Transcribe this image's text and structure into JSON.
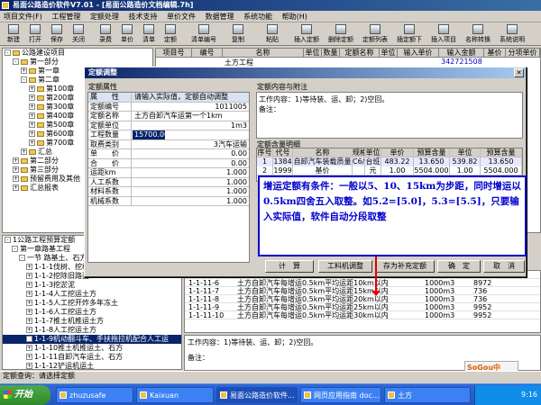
{
  "app": {
    "title": "易面公路造价软件V7.01 - [易面公路造价文档编辑.7h]"
  },
  "menu": [
    "项目文件(F)",
    "工程管理",
    "定额处理",
    "技术支持",
    "单价文件",
    "数据管理",
    "系统功能",
    "帮助(H)"
  ],
  "toolbar": [
    {
      "label": "新建",
      "icon": "new-file-icon"
    },
    {
      "label": "打开",
      "icon": "open-folder-icon"
    },
    {
      "label": "保存",
      "icon": "save-icon"
    },
    {
      "label": "关闭",
      "icon": "close-doc-icon"
    },
    {
      "label": "录费",
      "icon": "fee-icon"
    },
    {
      "label": "单价",
      "icon": "price-icon"
    },
    {
      "label": "清单",
      "icon": "list-icon"
    },
    {
      "label": "定额",
      "icon": "quota-icon"
    },
    {
      "label": "清单编号",
      "icon": "code-icon"
    },
    {
      "label": "复制",
      "icon": "copy-icon"
    },
    {
      "label": "粘贴",
      "icon": "paste-icon"
    },
    {
      "label": "插入定额",
      "icon": "insert-icon"
    },
    {
      "label": "删除定额",
      "icon": "delete-icon"
    },
    {
      "label": "定额列表",
      "icon": "quota-list-icon"
    },
    {
      "label": "插定额下",
      "icon": "insert-below-icon"
    },
    {
      "label": "插入项目",
      "icon": "insert-item-icon"
    },
    {
      "label": "名称转换",
      "icon": "convert-icon"
    },
    {
      "label": "系统说明",
      "icon": "help-doc-icon"
    }
  ],
  "left_tree": [
    {
      "label": "公路建设项目",
      "indent": 0,
      "box": "-"
    },
    {
      "label": "第一部分",
      "indent": 1,
      "box": "-"
    },
    {
      "label": "第一章",
      "indent": 2,
      "box": "+"
    },
    {
      "label": "第二章",
      "indent": 2,
      "box": "-"
    },
    {
      "label": "第100章",
      "indent": 3,
      "box": "+"
    },
    {
      "label": "第200章",
      "indent": 3,
      "box": "+"
    },
    {
      "label": "第300章",
      "indent": 3,
      "box": "+"
    },
    {
      "label": "第400章",
      "indent": 3,
      "box": "+"
    },
    {
      "label": "第500章",
      "indent": 3,
      "box": "+"
    },
    {
      "label": "第600章",
      "indent": 3,
      "box": "+"
    },
    {
      "label": "第700章",
      "indent": 3,
      "box": "+"
    },
    {
      "label": "汇总",
      "indent": 2,
      "box": "+"
    },
    {
      "label": "第二部分",
      "indent": 1,
      "box": "+"
    },
    {
      "label": "第三部分",
      "indent": 1,
      "box": "+"
    },
    {
      "label": "预留费用及其他",
      "indent": 1,
      "box": "+"
    },
    {
      "label": "汇总报表",
      "indent": 1,
      "box": "+"
    }
  ],
  "right_grid": {
    "headers": [
      "项目号",
      "编号",
      "名称",
      "单位",
      "数量",
      "定额名称",
      "单位",
      "输入单价",
      "输入金额",
      "基价",
      "分项单价"
    ],
    "row": {
      "name": "土方工程",
      "amount": "342721508"
    }
  },
  "left_tree2": [
    "1公路工程预算定额",
    "第一章路基工程",
    "一节 路基土、石方工程",
    "1-1-1伐树、挖根、除草",
    "1-1-2挖除旧路面",
    "1-1-3挖淤泥",
    "1-1-4人工挖运土方",
    "1-1-5人工挖开炸多年冻土",
    "1-1-6人工挖运土方",
    "1-1-7推土机推运土方",
    "1-1-8人工挖运土方",
    "1-1-9机动翻斗车、手扶拖拉机配合人工运",
    "1-1-10推土机推运土、石方",
    "1-1-11自卸汽车运土、石方",
    "1-1-12铲运机运土",
    "1-1-13平地机整平"
  ],
  "bottom_grid": [
    {
      "code": "1-1-11-5",
      "name": "土方自卸汽车运第一个1km",
      "unit": "1000m3",
      "price": "8972"
    },
    {
      "code": "1-1-11-6",
      "name": "土方自卸汽车每增运0.5km平均运距10km以内",
      "unit": "1000m3",
      "price": "8972"
    },
    {
      "code": "1-1-11-7",
      "name": "土方自卸汽车每增运0.5km平均运距15km以内",
      "unit": "1000m3",
      "price": "736"
    },
    {
      "code": "1-1-11-8",
      "name": "土方自卸汽车每增运0.5km平均运距20km以内",
      "unit": "1000m3",
      "price": "736"
    },
    {
      "code": "1-1-11-9",
      "name": "土方自卸汽车每增运0.5km平均运距25km以内",
      "unit": "1000m3",
      "price": "9952"
    },
    {
      "code": "1-1-11-10",
      "name": "土方自卸汽车每增运0.5km平均运距30km以内",
      "unit": "1000m3",
      "price": "9952"
    }
  ],
  "bottom_memo": {
    "content": "工作内容：1)等待装、运、卸；2)空回。",
    "note_label": "备注："
  },
  "statusbar": "定额查询：请选择定额",
  "dialog": {
    "title": "定额调整",
    "left_group_label": "定额属性",
    "right_group1_label": "定额内容与附注",
    "right_group2_label": "定额含量明细",
    "props": [
      {
        "label": "属　　性",
        "value": "请输入实际值，定额自动调整"
      },
      {
        "label": "定额编号",
        "value": "1011005",
        "align": "right"
      },
      {
        "label": "定额名称",
        "value": "土方自卸汽车运第一个1km"
      },
      {
        "label": "定额单位",
        "value": "1m3",
        "align": "right"
      },
      {
        "label": "工程数量",
        "value": "15700.000",
        "highlight": true
      },
      {
        "label": "取费类别",
        "value": "3汽车运输",
        "align": "right"
      },
      {
        "label": "单　　价",
        "value": "0.00",
        "align": "right"
      },
      {
        "label": "合　　价",
        "value": "0.00",
        "align": "right"
      },
      {
        "label": "运距km",
        "value": "1.000",
        "align": "right"
      },
      {
        "label": "人工系数",
        "value": "1.000",
        "align": "right"
      },
      {
        "label": "材料系数",
        "value": "1.000",
        "align": "right"
      },
      {
        "label": "机械系数",
        "value": "1.000",
        "align": "right"
      }
    ],
    "detail_text": "工作内容：1)等待装、运、卸；2)空回。\n备注：",
    "comp_headers": [
      "序号",
      "代号",
      "名称",
      "规格",
      "单位",
      "单价",
      "预算含量",
      "单位",
      "预算含量"
    ],
    "comp_rows": [
      [
        "1",
        "1384",
        "自卸汽车装载质量",
        "C6/t",
        "台班",
        "483.22",
        "13.650",
        "539.82",
        "13.650"
      ],
      [
        "2",
        "1999",
        "基价",
        "",
        "元",
        "1.00",
        "5504.000",
        "1.00",
        "5504.000"
      ]
    ],
    "annotation": "增运定额有条件：一般以5、10、15km为步距，同时增运以0.5km四舍五入取整。如5.2=[5.0]，5.3=[5.5]，只要输入实际值，软件自动分段取整",
    "buttons": {
      "calc": "计　算",
      "work": "工料机调整",
      "save_as": "存为补充定额",
      "ok": "确　定",
      "cancel": "取　消"
    }
  },
  "sogou_label": "SoGou中",
  "taskbar": {
    "start": "开始",
    "items": [
      "zhuzusafe",
      "Kaixuan",
      "易面公路造价软件...",
      "网页应用指南 doc...",
      "土方"
    ],
    "clock": "9:16"
  }
}
